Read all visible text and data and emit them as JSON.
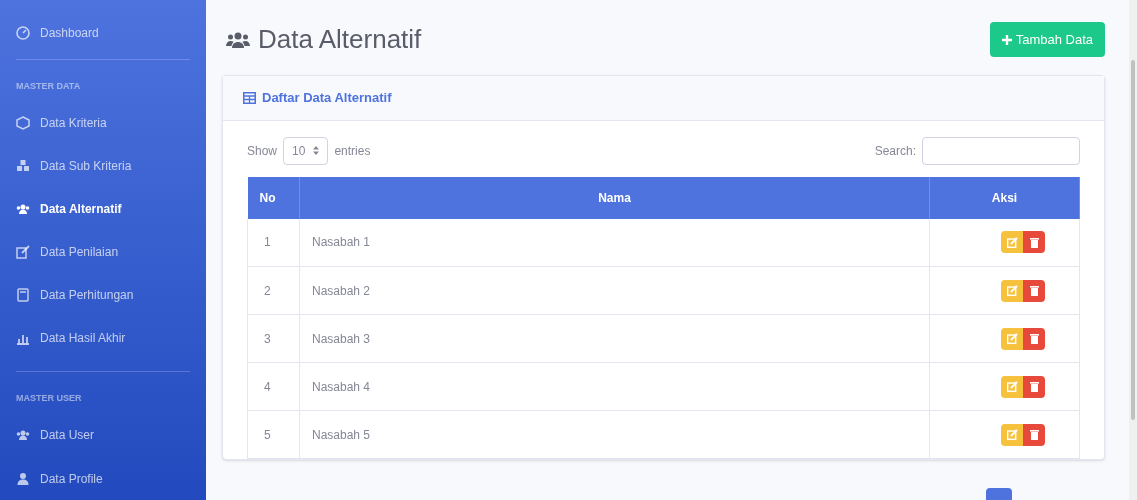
{
  "sidebar": {
    "items": [
      {
        "kind": "link",
        "label": "Dashboard",
        "selected": false
      },
      {
        "kind": "divider"
      },
      {
        "kind": "heading",
        "label": "MASTER DATA"
      },
      {
        "kind": "link",
        "label": "Data Kriteria",
        "selected": false
      },
      {
        "kind": "link",
        "label": "Data Sub Kriteria",
        "selected": false
      },
      {
        "kind": "link",
        "label": "Data Alternatif",
        "selected": true
      },
      {
        "kind": "link",
        "label": "Data Penilaian",
        "selected": false
      },
      {
        "kind": "link",
        "label": "Data Perhitungan",
        "selected": false
      },
      {
        "kind": "link",
        "label": "Data Hasil Akhir",
        "selected": false
      },
      {
        "kind": "divider"
      },
      {
        "kind": "heading",
        "label": "MASTER USER"
      },
      {
        "kind": "link",
        "label": "Data User",
        "selected": false
      },
      {
        "kind": "link",
        "label": "Data Profile",
        "selected": false
      }
    ]
  },
  "page_title": "Data Alternatif",
  "add_button": "Tambah Data",
  "card": {
    "title": "Daftar Data Alternatif",
    "length": {
      "before": "Show",
      "value": "10",
      "after": "entries"
    },
    "search": {
      "label": "Search:"
    },
    "table": {
      "columns": [
        "No",
        "Nama",
        "Aksi"
      ],
      "rows": [
        {
          "no": "1",
          "nama": "Nasabah 1"
        },
        {
          "no": "2",
          "nama": "Nasabah 2"
        },
        {
          "no": "3",
          "nama": "Nasabah 3"
        },
        {
          "no": "4",
          "nama": "Nasabah 4"
        },
        {
          "no": "5",
          "nama": "Nasabah 5"
        }
      ]
    }
  }
}
